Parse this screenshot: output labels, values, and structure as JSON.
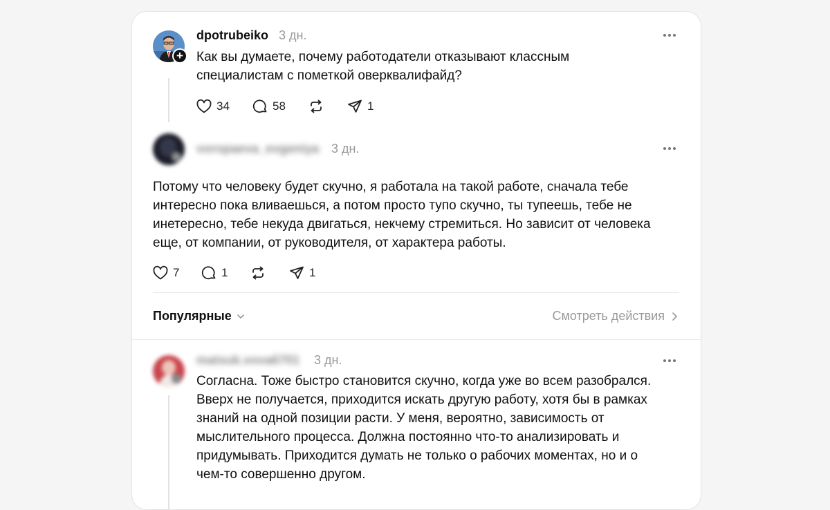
{
  "post": {
    "username": "dpotrubeiko",
    "time": "3 дн.",
    "text_lines": [
      "Как вы думаете, почему работодатели отказывают классным",
      "специалистам с пометкой оверквалифайд?"
    ],
    "likes": "34",
    "comments": "58",
    "reposts": "",
    "shares": "1"
  },
  "reply1": {
    "username": "voropaeva_evgeniya",
    "time": "3 дн.",
    "text_lines": [
      "Потому что человеку будет скучно, я работала на такой работе, сначала тебе",
      "интересно пока вливаешься, а потом просто тупо скучно, ты тупеешь, тебе не",
      "инетересно, тебе некуда двигаться, некчему стремиться. Но зависит от человека",
      "еще, от компании, от руководителя, от характера работы."
    ],
    "likes": "7",
    "comments": "1",
    "shares": "1"
  },
  "sort_bar": {
    "sort_label": "Популярные",
    "view_activity_label": "Смотреть действия"
  },
  "reply2": {
    "username": "matsuk.vova6701",
    "time": "3 дн.",
    "text_lines": [
      "Согласна. Тоже быстро становится скучно, когда уже во всем разобрался.",
      "Вверх не получается, приходится искать другую работу, хотя бы в рамках",
      "знаний на одной позиции расти. У меня, вероятно, зависимость от",
      "мыслительного процесса. Должна постоянно что-то анализировать и",
      "придумывать. Приходится думать не только о рабочих моментах, но и о",
      "чем-то совершенно другом."
    ]
  },
  "icons": {
    "like": "heart-icon",
    "comment": "comment-icon",
    "repost": "repost-icon",
    "share": "share-icon",
    "more": "more-icon",
    "chevron_down": "chevron-down-icon",
    "chevron_right": "chevron-right-icon"
  }
}
